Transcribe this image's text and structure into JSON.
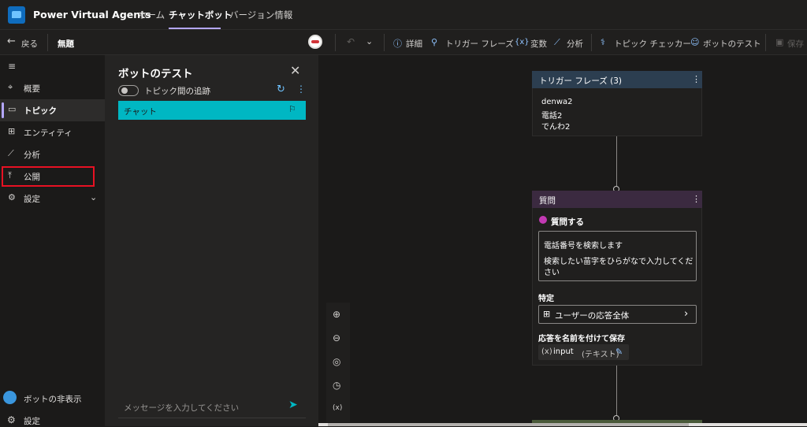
{
  "app": {
    "title": "Power Virtual Agents"
  },
  "top_nav": {
    "tabs": [
      "ホーム",
      "チャットボット",
      "バージョン情報"
    ],
    "active_tab": "チャットボット"
  },
  "command_bar": {
    "back_label": "戻る",
    "topic_name": "無題",
    "details_label": "詳細",
    "trigger_phrases_label": "トリガー フレーズ",
    "variables_label": "変数",
    "analytics_label": "分析",
    "topic_checker_label": "トピック チェッカー",
    "test_bot_label": "ボットのテスト",
    "save_label": "保存"
  },
  "left_nav": {
    "items": [
      {
        "label": "概要",
        "icon": "overview-icon"
      },
      {
        "label": "トピック",
        "icon": "topics-icon",
        "active": true
      },
      {
        "label": "エンティティ",
        "icon": "entity-icon"
      },
      {
        "label": "分析",
        "icon": "analytics-icon"
      },
      {
        "label": "公開",
        "icon": "publish-icon",
        "highlighted": true
      },
      {
        "label": "設定",
        "icon": "settings-icon"
      }
    ],
    "hide_bot_label": "ボットの非表示",
    "bottom_settings_label": "設定"
  },
  "test_panel": {
    "title": "ボットのテスト",
    "track_topics_label": "トピック間の追跡",
    "track_topics_enabled": false,
    "chat_tab_label": "チャット",
    "input_placeholder": "メッセージを入力してください"
  },
  "canvas": {
    "trigger_card": {
      "title": "トリガー フレーズ (3)",
      "phrases": [
        "denwa2",
        "電話2",
        "でんわ2"
      ]
    },
    "question_card": {
      "title": "質問",
      "ask_label": "質問する",
      "message_lines": [
        "電話番号を検索します",
        "検索したい苗字をひらがなで入力してくだ",
        "さい"
      ],
      "identify_label": "特定",
      "identify_value": "ユーザーの応答全体",
      "save_response_label": "応答を名前を付けて保存",
      "variable_prefix": "(x)",
      "variable_name": "input",
      "variable_type": "(テキスト)"
    },
    "zoom_tools": [
      "zoom-in-icon",
      "zoom-out-icon",
      "fit-icon",
      "history-icon",
      "variable-icon"
    ]
  },
  "colors": {
    "accent": "#b4a7ff",
    "chat_tab": "#00b7c3",
    "publish_highlight": "#e81123",
    "trigger_header": "#2c3e50",
    "question_header": "#3b2a40"
  }
}
